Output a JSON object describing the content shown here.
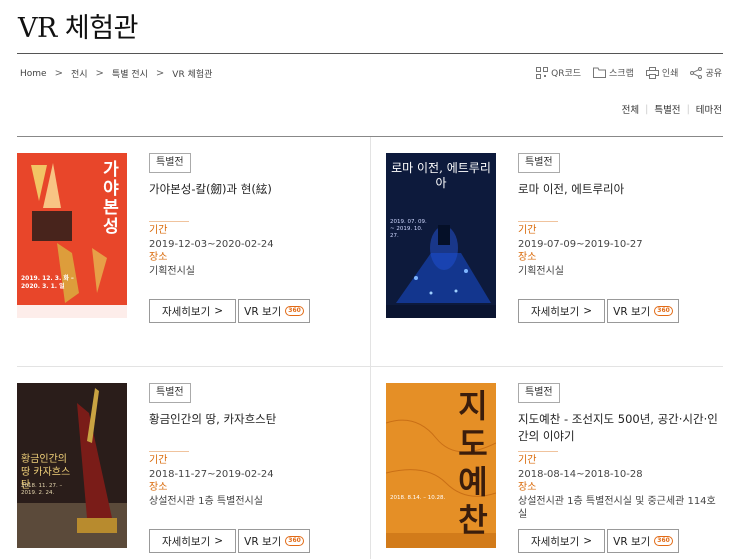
{
  "page": {
    "title": "VR 체험관"
  },
  "breadcrumb": [
    "Home",
    "전시",
    "특별 전시",
    "VR 체험관"
  ],
  "tools": [
    {
      "icon": "qr-code-icon",
      "label": "QR코드"
    },
    {
      "icon": "folder-icon",
      "label": "스크랩"
    },
    {
      "icon": "printer-icon",
      "label": "인쇄"
    },
    {
      "icon": "share-icon",
      "label": "공유"
    }
  ],
  "filters": [
    "전체",
    "특별전",
    "테마전"
  ],
  "labels": {
    "period": "기간",
    "place": "장소",
    "detail": "자세히보기",
    "vr": "VR 보기",
    "vr_badge": "360"
  },
  "colors": {
    "accent": "#d96a0a"
  },
  "exhibitions": [
    {
      "badge": "특별전",
      "title": "가야본성-칼(劒)과 현(絃)",
      "period": "2019-12-03~2020-02-24",
      "place": "기획전시실",
      "poster": {
        "bg": "#e8462a",
        "text": "가야본성",
        "date": "2019. 12. 3. 화 – 2020. 3. 1. 일"
      }
    },
    {
      "badge": "특별전",
      "title": "로마 이전, 에트루리아",
      "period": "2019-07-09~2019-10-27",
      "place": "기획전시실",
      "poster": {
        "bg": "#0d1a3c",
        "text": "로마 이전, 에트루리아",
        "date": "2019. 07. 09. ~ 2019. 10. 27."
      }
    },
    {
      "badge": "특별전",
      "title": "황금인간의 땅, 카자흐스탄",
      "period": "2018-11-27~2019-02-24",
      "place": "상설전시관 1층 특별전시실",
      "poster": {
        "bg": "#2a1d1a",
        "text": "황금인간의 땅 카자흐스탄",
        "date": "2018. 11. 27. – 2019. 2. 24."
      }
    },
    {
      "badge": "특별전",
      "title": "지도예찬 - 조선지도 500년, 공간·시간·인간의 이야기",
      "period": "2018-08-14~2018-10-28",
      "place": "상설전시관 1층 특별전시실 및 중근세관 114호실",
      "poster": {
        "bg": "#e58f26",
        "text": "지도예찬",
        "date": "2018. 8.14. – 10.28."
      }
    }
  ]
}
